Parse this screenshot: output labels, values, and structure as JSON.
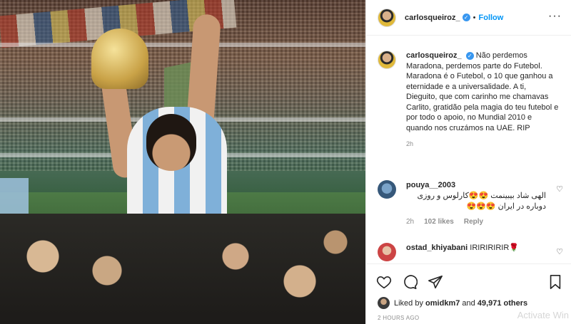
{
  "post": {
    "author": "carlosqueiroz_",
    "follow_label": "Follow",
    "dot": "•",
    "more_icon": "more-horizontal-icon",
    "caption": "Não perdemos Maradona, perdemos parte do Futebol. Maradona é o Futebol, o 10 que ganhou a eternidade e a universalidade. A ti, Dieguito, que com carinho me chamavas Carlito, gratidão pela magia do teu futebol e por todo o apoio, no Mundial 2010 e quando nos cruzámos na UAE. RIP",
    "caption_time": "2h"
  },
  "comments": [
    {
      "username": "pouya__2003",
      "text": "الهی شاد بیبینمت 😍😍کارلوس و روزی دوباره در ایران 😍😍😍",
      "time": "2h",
      "likes": "102 likes",
      "reply": "Reply"
    },
    {
      "username": "ostad_khiyabani",
      "text": "IRIRIRIRIR🌹"
    }
  ],
  "actions": {
    "liked_by_prefix": "Liked by",
    "liked_by_user": "omidkm7",
    "liked_by_and": "and",
    "liked_by_others": "49,971 others",
    "posted_time": "2 HOURS AGO"
  },
  "overlay": {
    "watermark": "Activate Win"
  },
  "colors": {
    "accent": "#0095f6",
    "verified": "#3897f0",
    "muted": "#8e8e8e"
  }
}
